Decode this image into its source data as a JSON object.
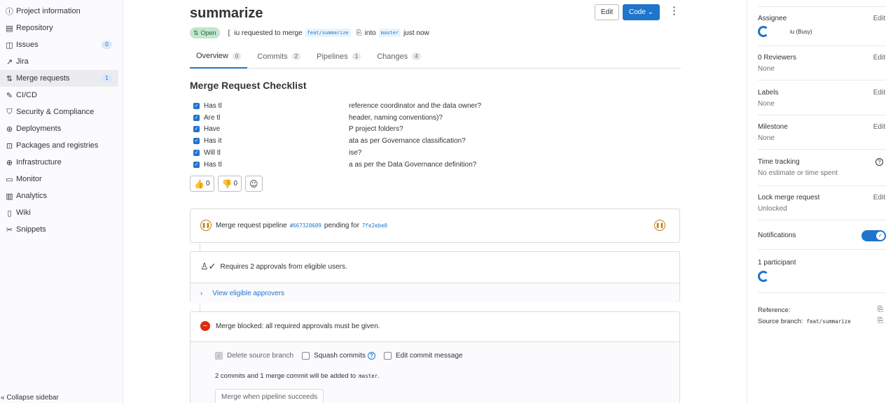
{
  "nav": {
    "items": [
      {
        "icon": "info-icon",
        "glyph": "ⓘ",
        "label": "Project information"
      },
      {
        "icon": "repository-icon",
        "glyph": "▤",
        "label": "Repository"
      },
      {
        "icon": "issues-icon",
        "glyph": "◫",
        "label": "Issues",
        "count": "0"
      },
      {
        "icon": "jira-icon",
        "glyph": "↗",
        "label": "Jira"
      },
      {
        "icon": "merge-request-icon",
        "glyph": "⇅",
        "label": "Merge requests",
        "count": "1",
        "active": true
      },
      {
        "icon": "cicd-icon",
        "glyph": "✎",
        "label": "CI/CD"
      },
      {
        "icon": "shield-icon",
        "glyph": "⛉",
        "label": "Security & Compliance"
      },
      {
        "icon": "deployments-icon",
        "glyph": "⊛",
        "label": "Deployments"
      },
      {
        "icon": "package-icon",
        "glyph": "⊡",
        "label": "Packages and registries"
      },
      {
        "icon": "infrastructure-icon",
        "glyph": "⊕",
        "label": "Infrastructure"
      },
      {
        "icon": "monitor-icon",
        "glyph": "▭",
        "label": "Monitor"
      },
      {
        "icon": "analytics-icon",
        "glyph": "▥",
        "label": "Analytics"
      },
      {
        "icon": "wiki-icon",
        "glyph": "▯",
        "label": "Wiki"
      },
      {
        "icon": "snippets-icon",
        "glyph": "✂",
        "label": "Snippets"
      }
    ],
    "collapse_label": "« Collapse sidebar"
  },
  "mr": {
    "title": "summarize",
    "edit_label": "Edit",
    "code_label": "Code ⌄",
    "status": "Open",
    "author_initial": "[",
    "author_tail": "iu requested to merge",
    "source_branch": "feat/summarize",
    "into": "into",
    "target_branch": "master",
    "time": "just now"
  },
  "tabs": [
    {
      "label": "Overview",
      "count": "0"
    },
    {
      "label": "Commits",
      "count": "2"
    },
    {
      "label": "Pipelines",
      "count": "1"
    },
    {
      "label": "Changes",
      "count": "4"
    }
  ],
  "description": {
    "heading": "Merge Request Checklist",
    "items": [
      {
        "head": "Has tl",
        "tail": "reference coordinator and the data owner?"
      },
      {
        "head": "Are tl",
        "tail": "header, naming conventions)?"
      },
      {
        "head": "Have",
        "tail": "P project folders?"
      },
      {
        "head": "Has it",
        "tail": "ata as per Governance classification?"
      },
      {
        "head": "Will tl",
        "tail": "ise?"
      },
      {
        "head": "Has tl",
        "tail": "a as per the Data Governance definition?"
      }
    ]
  },
  "reactions": {
    "thumbs_up": "0",
    "thumbs_down": "0"
  },
  "pipeline": {
    "text": "Merge request pipeline",
    "id": "#667320609",
    "status": "pending for",
    "sha": "7fe2ebe0"
  },
  "approval": {
    "text": "Requires 2 approvals from eligible users.",
    "link": "View eligible approvers"
  },
  "merge": {
    "blocked": "Merge blocked: all required approvals must be given.",
    "delete_branch": "Delete source branch",
    "squash": "Squash commits",
    "edit_message": "Edit commit message",
    "summary_prefix": "2 commits and 1 merge commit will be added to",
    "summary_branch": "master",
    "button": "Merge when pipeline succeeds"
  },
  "sidebar": {
    "assignee_title": "Assignee",
    "assignee_name": "iu (Busy)",
    "reviewers_title": "0 Reviewers",
    "reviewers_val": "None",
    "labels_title": "Labels",
    "labels_val": "None",
    "milestone_title": "Milestone",
    "milestone_val": "None",
    "time_title": "Time tracking",
    "time_val": "No estimate or time spent",
    "lock_title": "Lock merge request",
    "lock_val": "Unlocked",
    "notifications_title": "Notifications",
    "participants_title": "1 participant",
    "reference_label": "Reference:",
    "source_branch_label": "Source branch:",
    "source_branch_val": "feat/summarize",
    "edit_label": "Edit"
  }
}
